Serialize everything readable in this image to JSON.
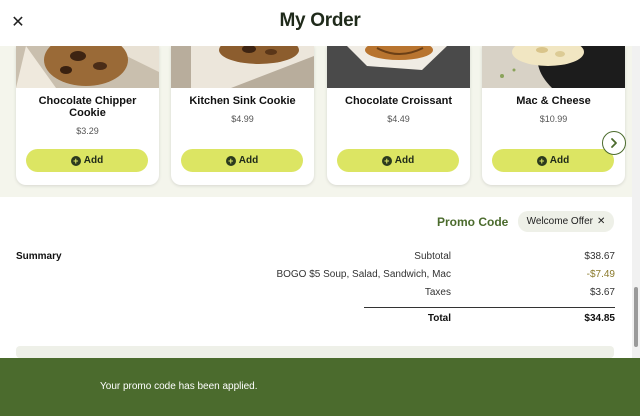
{
  "header": {
    "title": "My Order",
    "close_icon": "close-icon"
  },
  "carousel": {
    "add_label": "Add",
    "items": [
      {
        "name": "Chocolate Chipper Cookie",
        "price": "$3.29",
        "image": "cookie-image"
      },
      {
        "name": "Kitchen Sink Cookie",
        "price": "$4.99",
        "image": "cookie-image"
      },
      {
        "name": "Chocolate Croissant",
        "price": "$4.49",
        "image": "croissant-image"
      },
      {
        "name": "Mac & Cheese",
        "price": "$10.99",
        "image": "mac-and-cheese-image"
      }
    ],
    "next_icon": "chevron-right-icon"
  },
  "promo": {
    "label": "Promo Code",
    "chip": "Welcome Offer"
  },
  "summary": {
    "label": "Summary",
    "rows": [
      {
        "label": "Subtotal",
        "value": "$38.67"
      },
      {
        "label": "BOGO $5 Soup, Salad, Sandwich, Mac",
        "value": "-$7.49"
      },
      {
        "label": "Taxes",
        "value": "$3.67"
      }
    ],
    "total_label": "Total",
    "total_value": "$34.85"
  },
  "toast": {
    "message": "Your promo code has been applied."
  },
  "colors": {
    "brand_green": "#4b6b2d",
    "accent_lime": "#dce563",
    "discount": "#8a7a2c"
  }
}
